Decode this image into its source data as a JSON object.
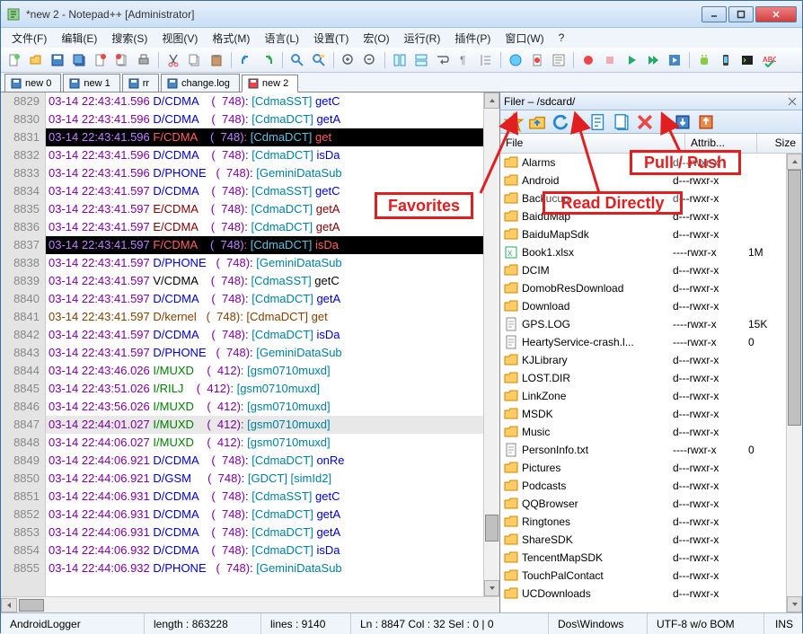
{
  "title": "*new  2 - Notepad++ [Administrator]",
  "menu": [
    "文件(F)",
    "编辑(E)",
    "搜索(S)",
    "视图(V)",
    "格式(M)",
    "语言(L)",
    "设置(T)",
    "宏(O)",
    "运行(R)",
    "插件(P)",
    "窗口(W)",
    "?"
  ],
  "tabs": [
    {
      "label": "new  0",
      "active": false,
      "saved": true
    },
    {
      "label": "new  1",
      "active": false,
      "saved": true
    },
    {
      "label": "rr",
      "active": false,
      "saved": true
    },
    {
      "label": "change.log",
      "active": false,
      "saved": true
    },
    {
      "label": "new  2",
      "active": true,
      "saved": false
    }
  ],
  "lines": [
    {
      "num": 8829,
      "cls": "",
      "parts": [
        [
          "purple",
          "03-14 22:43:41.596 "
        ],
        [
          "blue",
          "D/CDMA    "
        ],
        [
          "purple",
          "(  748)"
        ],
        [
          "blue",
          ": "
        ],
        [
          "teal",
          "[CdmaSST] "
        ],
        [
          "blue",
          "getC"
        ]
      ]
    },
    {
      "num": 8830,
      "cls": "",
      "parts": [
        [
          "purple",
          "03-14 22:43:41.596 "
        ],
        [
          "blue",
          "D/CDMA    "
        ],
        [
          "purple",
          "(  748)"
        ],
        [
          "blue",
          ": "
        ],
        [
          "teal",
          "[CdmaDCT] "
        ],
        [
          "blue",
          "getA"
        ]
      ]
    },
    {
      "num": 8831,
      "cls": "hl-dark",
      "parts": [
        [
          "purple",
          "03-14 22:43:41.596 "
        ],
        [
          "red",
          "F/CDMA    "
        ],
        [
          "purple",
          "(  748)"
        ],
        [
          "red",
          ": "
        ],
        [
          "teal",
          "[CdmaDCT] "
        ],
        [
          "red",
          "get"
        ]
      ]
    },
    {
      "num": 8832,
      "cls": "",
      "parts": [
        [
          "purple",
          "03-14 22:43:41.596 "
        ],
        [
          "blue",
          "D/CDMA    "
        ],
        [
          "purple",
          "(  748)"
        ],
        [
          "blue",
          ": "
        ],
        [
          "teal",
          "[CdmaDCT] "
        ],
        [
          "blue",
          "isDa"
        ]
      ]
    },
    {
      "num": 8833,
      "cls": "",
      "parts": [
        [
          "purple",
          "03-14 22:43:41.596 "
        ],
        [
          "blue",
          "D/PHONE   "
        ],
        [
          "purple",
          "(  748)"
        ],
        [
          "blue",
          ": "
        ],
        [
          "teal",
          "[GeminiDataSub"
        ]
      ]
    },
    {
      "num": 8834,
      "cls": "",
      "parts": [
        [
          "purple",
          "03-14 22:43:41.597 "
        ],
        [
          "blue",
          "D/CDMA    "
        ],
        [
          "purple",
          "(  748)"
        ],
        [
          "blue",
          ": "
        ],
        [
          "teal",
          "[CdmaSST] "
        ],
        [
          "blue",
          "getC"
        ]
      ]
    },
    {
      "num": 8835,
      "cls": "",
      "parts": [
        [
          "purple",
          "03-14 22:43:41.597 "
        ],
        [
          "maroon",
          "E/CDMA    "
        ],
        [
          "purple",
          "(  748)"
        ],
        [
          "maroon",
          ": "
        ],
        [
          "teal",
          "[CdmaDCT] "
        ],
        [
          "maroon",
          "getA"
        ]
      ]
    },
    {
      "num": 8836,
      "cls": "",
      "parts": [
        [
          "purple",
          "03-14 22:43:41.597 "
        ],
        [
          "maroon",
          "E/CDMA    "
        ],
        [
          "purple",
          "(  748)"
        ],
        [
          "maroon",
          ": "
        ],
        [
          "teal",
          "[CdmaDCT] "
        ],
        [
          "maroon",
          "getA"
        ]
      ]
    },
    {
      "num": 8837,
      "cls": "hl-dark",
      "parts": [
        [
          "purple",
          "03-14 22:43:41.597 "
        ],
        [
          "red",
          "F/CDMA    "
        ],
        [
          "purple",
          "(  748)"
        ],
        [
          "red",
          ": "
        ],
        [
          "teal",
          "[CdmaDCT] "
        ],
        [
          "red",
          "isDa"
        ]
      ]
    },
    {
      "num": 8838,
      "cls": "",
      "parts": [
        [
          "purple",
          "03-14 22:43:41.597 "
        ],
        [
          "blue",
          "D/PHONE   "
        ],
        [
          "purple",
          "(  748)"
        ],
        [
          "blue",
          ": "
        ],
        [
          "teal",
          "[GeminiDataSub"
        ]
      ]
    },
    {
      "num": 8839,
      "cls": "",
      "parts": [
        [
          "purple",
          "03-14 22:43:41.597 "
        ],
        [
          "black",
          "V/CDMA    "
        ],
        [
          "purple",
          "(  748)"
        ],
        [
          "black",
          ": "
        ],
        [
          "teal",
          "[CdmaSST] "
        ],
        [
          "black",
          "getC"
        ]
      ]
    },
    {
      "num": 8840,
      "cls": "",
      "parts": [
        [
          "purple",
          "03-14 22:43:41.597 "
        ],
        [
          "blue",
          "D/CDMA    "
        ],
        [
          "purple",
          "(  748)"
        ],
        [
          "blue",
          ": "
        ],
        [
          "teal",
          "[CdmaDCT] "
        ],
        [
          "blue",
          "getA"
        ]
      ]
    },
    {
      "num": 8841,
      "cls": "",
      "parts": [
        [
          "brown",
          "03-14 22:43:41.597 D/kernel   (  748): [CdmaDCT] get"
        ]
      ]
    },
    {
      "num": 8842,
      "cls": "",
      "parts": [
        [
          "purple",
          "03-14 22:43:41.597 "
        ],
        [
          "blue",
          "D/CDMA    "
        ],
        [
          "purple",
          "(  748)"
        ],
        [
          "blue",
          ": "
        ],
        [
          "teal",
          "[CdmaDCT] "
        ],
        [
          "blue",
          "isDa"
        ]
      ]
    },
    {
      "num": 8843,
      "cls": "",
      "parts": [
        [
          "purple",
          "03-14 22:43:41.597 "
        ],
        [
          "blue",
          "D/PHONE   "
        ],
        [
          "purple",
          "(  748)"
        ],
        [
          "blue",
          ": "
        ],
        [
          "teal",
          "[GeminiDataSub"
        ]
      ]
    },
    {
      "num": 8844,
      "cls": "",
      "parts": [
        [
          "purple",
          "03-14 22:43:46.026 "
        ],
        [
          "green",
          "I/MUXD    "
        ],
        [
          "purple",
          "(  412)"
        ],
        [
          "green",
          ": "
        ],
        [
          "teal",
          "[gsm0710muxd]"
        ]
      ]
    },
    {
      "num": 8845,
      "cls": "",
      "parts": [
        [
          "purple",
          "03-14 22:43:51.026 "
        ],
        [
          "green",
          "I/RILJ    "
        ],
        [
          "purple",
          "(  412)"
        ],
        [
          "green",
          ": "
        ],
        [
          "teal",
          "[gsm0710muxd]"
        ]
      ]
    },
    {
      "num": 8846,
      "cls": "",
      "parts": [
        [
          "purple",
          "03-14 22:43:56.026 "
        ],
        [
          "green",
          "I/MUXD    "
        ],
        [
          "purple",
          "(  412)"
        ],
        [
          "green",
          ": "
        ],
        [
          "teal",
          "[gsm0710muxd]"
        ]
      ]
    },
    {
      "num": 8847,
      "cls": "hl-cursor",
      "parts": [
        [
          "purple",
          "03-14 22:44:01.027 "
        ],
        [
          "green",
          "I/MUXD    "
        ],
        [
          "purple",
          "(  412)"
        ],
        [
          "green",
          ": "
        ],
        [
          "teal",
          "[gsm0710muxd]"
        ]
      ]
    },
    {
      "num": 8848,
      "cls": "",
      "parts": [
        [
          "purple",
          "03-14 22:44:06.027 "
        ],
        [
          "green",
          "I/MUXD    "
        ],
        [
          "purple",
          "(  412)"
        ],
        [
          "green",
          ": "
        ],
        [
          "teal",
          "[gsm0710muxd]"
        ]
      ]
    },
    {
      "num": 8849,
      "cls": "",
      "parts": [
        [
          "purple",
          "03-14 22:44:06.921 "
        ],
        [
          "blue",
          "D/CDMA    "
        ],
        [
          "purple",
          "(  748)"
        ],
        [
          "blue",
          ": "
        ],
        [
          "teal",
          "[CdmaDCT] "
        ],
        [
          "blue",
          "onRe"
        ]
      ]
    },
    {
      "num": 8850,
      "cls": "",
      "parts": [
        [
          "purple",
          "03-14 22:44:06.921 "
        ],
        [
          "blue",
          "D/GSM     "
        ],
        [
          "purple",
          "(  748)"
        ],
        [
          "blue",
          ": "
        ],
        [
          "teal",
          "[GDCT] [simId2]"
        ]
      ]
    },
    {
      "num": 8851,
      "cls": "",
      "parts": [
        [
          "purple",
          "03-14 22:44:06.931 "
        ],
        [
          "blue",
          "D/CDMA    "
        ],
        [
          "purple",
          "(  748)"
        ],
        [
          "blue",
          ": "
        ],
        [
          "teal",
          "[CdmaSST] "
        ],
        [
          "blue",
          "getC"
        ]
      ]
    },
    {
      "num": 8852,
      "cls": "",
      "parts": [
        [
          "purple",
          "03-14 22:44:06.931 "
        ],
        [
          "blue",
          "D/CDMA    "
        ],
        [
          "purple",
          "(  748)"
        ],
        [
          "blue",
          ": "
        ],
        [
          "teal",
          "[CdmaDCT] "
        ],
        [
          "blue",
          "getA"
        ]
      ]
    },
    {
      "num": 8853,
      "cls": "",
      "parts": [
        [
          "purple",
          "03-14 22:44:06.931 "
        ],
        [
          "blue",
          "D/CDMA    "
        ],
        [
          "purple",
          "(  748)"
        ],
        [
          "blue",
          ": "
        ],
        [
          "teal",
          "[CdmaDCT] "
        ],
        [
          "blue",
          "getA"
        ]
      ]
    },
    {
      "num": 8854,
      "cls": "",
      "parts": [
        [
          "purple",
          "03-14 22:44:06.932 "
        ],
        [
          "blue",
          "D/CDMA    "
        ],
        [
          "purple",
          "(  748)"
        ],
        [
          "blue",
          ": "
        ],
        [
          "teal",
          "[CdmaDCT] "
        ],
        [
          "blue",
          "isDa"
        ]
      ]
    },
    {
      "num": 8855,
      "cls": "",
      "parts": [
        [
          "purple",
          "03-14 22:44:06.932 "
        ],
        [
          "blue",
          "D/PHONE   "
        ],
        [
          "purple",
          "(  748)"
        ],
        [
          "blue",
          ": "
        ],
        [
          "teal",
          "[GeminiDataSub"
        ]
      ]
    }
  ],
  "filer": {
    "title": "Filer – /sdcard/",
    "cols": {
      "file": "File",
      "attr": "Attrib...",
      "size": "Size"
    },
    "items": [
      {
        "name": "Alarms",
        "type": "folder",
        "attr": "d---rwxr-x",
        "size": ""
      },
      {
        "name": "Android",
        "type": "folder",
        "attr": "d---rwxr-x",
        "size": ""
      },
      {
        "name": "Backucup",
        "type": "folder",
        "attr": "d---rwxr-x",
        "size": ""
      },
      {
        "name": "BaiduMap",
        "type": "folder",
        "attr": "d---rwxr-x",
        "size": ""
      },
      {
        "name": "BaiduMapSdk",
        "type": "folder",
        "attr": "d---rwxr-x",
        "size": ""
      },
      {
        "name": "Book1.xlsx",
        "type": "xlsx",
        "attr": "----rwxr-x",
        "size": "1M"
      },
      {
        "name": "DCIM",
        "type": "folder",
        "attr": "d---rwxr-x",
        "size": ""
      },
      {
        "name": "DomobResDownload",
        "type": "folder",
        "attr": "d---rwxr-x",
        "size": ""
      },
      {
        "name": "Download",
        "type": "folder",
        "attr": "d---rwxr-x",
        "size": ""
      },
      {
        "name": "GPS.LOG",
        "type": "file",
        "attr": "----rwxr-x",
        "size": "15K"
      },
      {
        "name": "HeartyService-crash.l...",
        "type": "file",
        "attr": "----rwxr-x",
        "size": "0"
      },
      {
        "name": "KJLibrary",
        "type": "folder",
        "attr": "d---rwxr-x",
        "size": ""
      },
      {
        "name": "LOST.DIR",
        "type": "folder",
        "attr": "d---rwxr-x",
        "size": ""
      },
      {
        "name": "LinkZone",
        "type": "folder",
        "attr": "d---rwxr-x",
        "size": ""
      },
      {
        "name": "MSDK",
        "type": "folder",
        "attr": "d---rwxr-x",
        "size": ""
      },
      {
        "name": "Music",
        "type": "folder",
        "attr": "d---rwxr-x",
        "size": ""
      },
      {
        "name": "PersonInfo.txt",
        "type": "file",
        "attr": "----rwxr-x",
        "size": "0"
      },
      {
        "name": "Pictures",
        "type": "folder",
        "attr": "d---rwxr-x",
        "size": ""
      },
      {
        "name": "Podcasts",
        "type": "folder",
        "attr": "d---rwxr-x",
        "size": ""
      },
      {
        "name": "QQBrowser",
        "type": "folder",
        "attr": "d---rwxr-x",
        "size": ""
      },
      {
        "name": "Ringtones",
        "type": "folder",
        "attr": "d---rwxr-x",
        "size": ""
      },
      {
        "name": "ShareSDK",
        "type": "folder",
        "attr": "d---rwxr-x",
        "size": ""
      },
      {
        "name": "TencentMapSDK",
        "type": "folder",
        "attr": "d---rwxr-x",
        "size": ""
      },
      {
        "name": "TouchPalContact",
        "type": "folder",
        "attr": "d---rwxr-x",
        "size": ""
      },
      {
        "name": "UCDownloads",
        "type": "folder",
        "attr": "d---rwxr-x",
        "size": ""
      }
    ]
  },
  "status": {
    "mode": "AndroidLogger",
    "length": "length : 863228",
    "lines": "lines : 9140",
    "pos": "Ln : 8847    Col : 32    Sel : 0 | 0",
    "eol": "Dos\\Windows",
    "enc": "UTF-8 w/o BOM",
    "ins": "INS"
  },
  "anno": {
    "favorites": "Favorites",
    "read": "Read Directly",
    "pullpush": "Pull / Push"
  }
}
